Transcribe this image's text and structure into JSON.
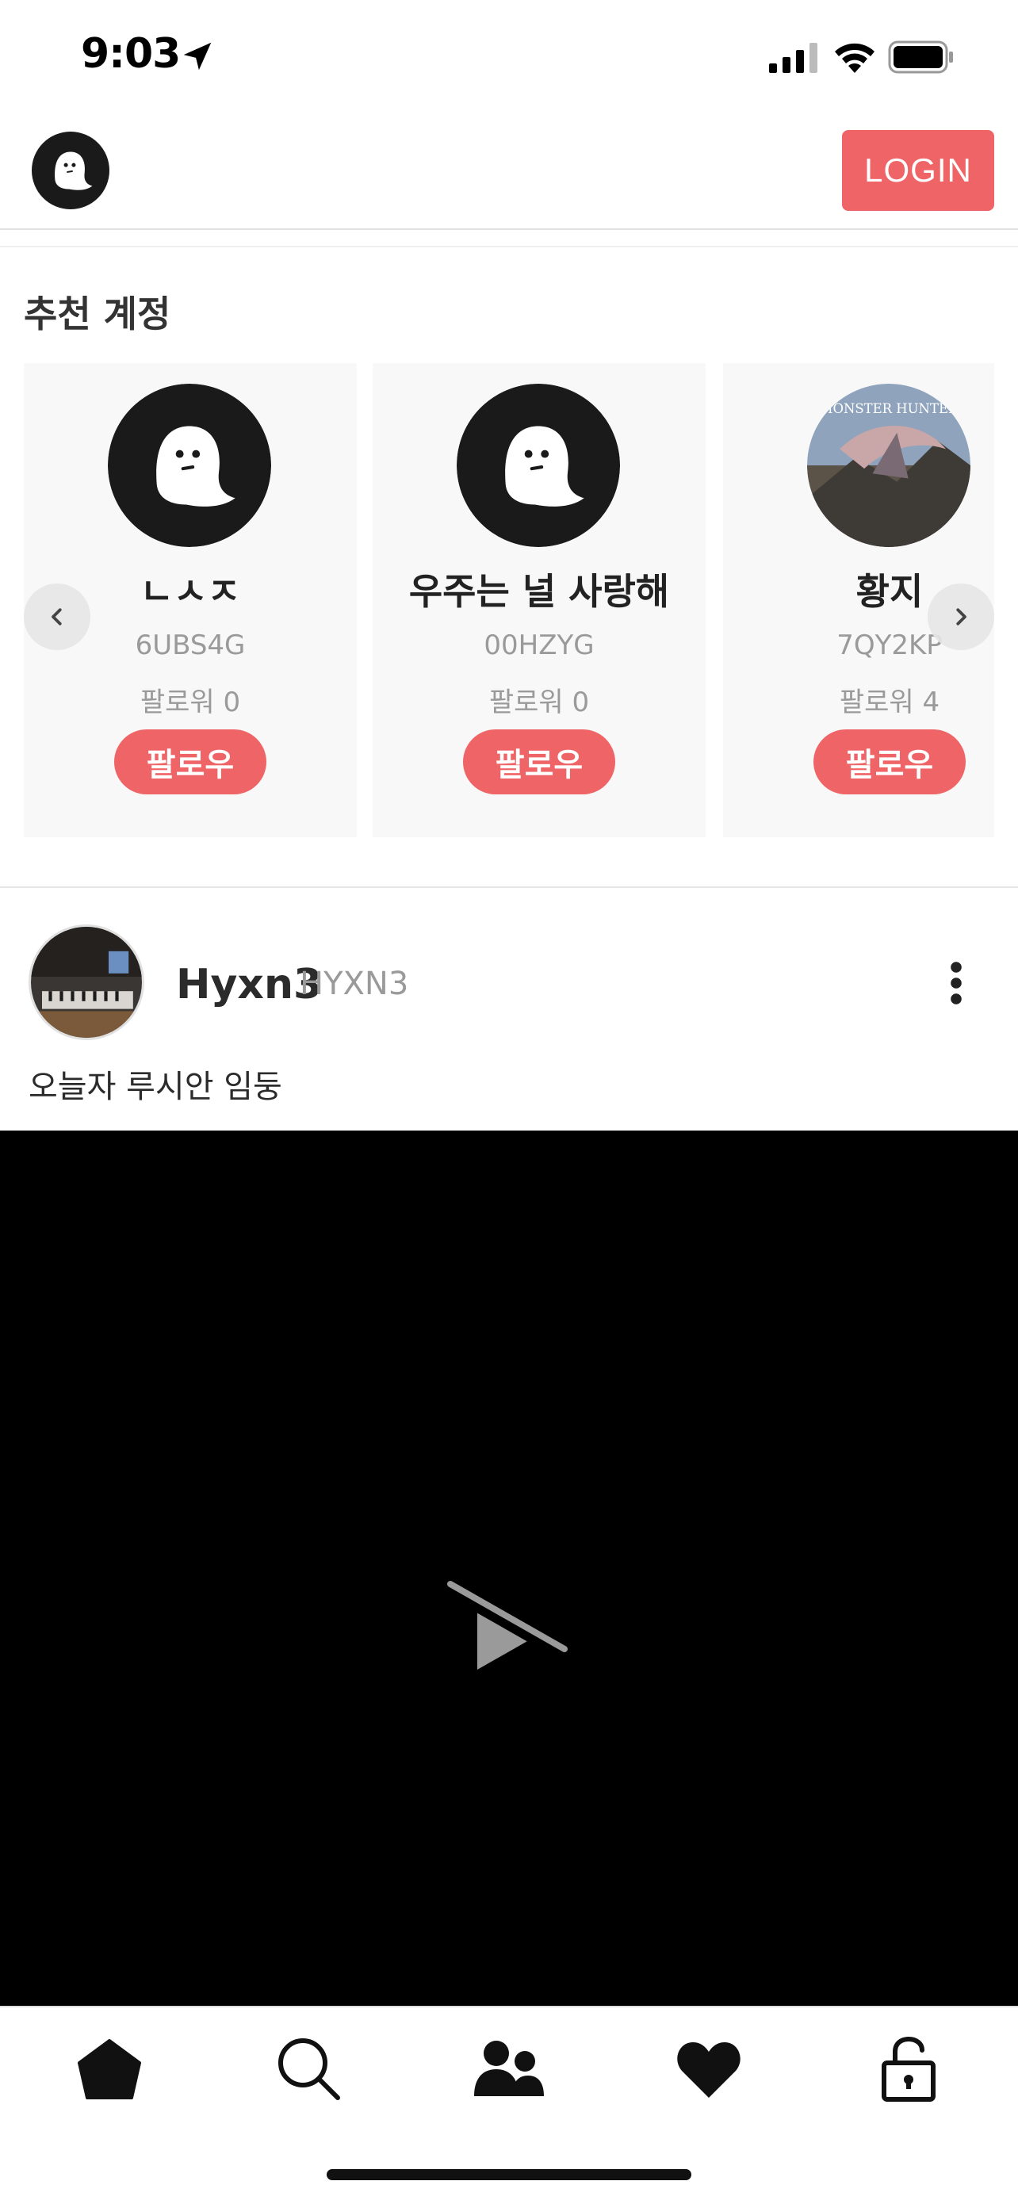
{
  "status_bar": {
    "time": "9:03"
  },
  "header": {
    "login_label": "LOGIN"
  },
  "recommended": {
    "title": "추천 계정",
    "follow_label": "팔로우",
    "accounts": [
      {
        "name": "ㄴㅅㅈ",
        "handle": "6UBS4G",
        "followers": "팔로워 0",
        "avatar": "ghost-avatar"
      },
      {
        "name": "우주는 널 사랑해",
        "handle": "00HZYG",
        "followers": "팔로워 0",
        "avatar": "ghost-avatar"
      },
      {
        "name": "황지",
        "handle": "7QY2KP",
        "followers": "팔로워 4",
        "avatar": "monster-hunter-avatar"
      }
    ]
  },
  "post": {
    "author": "Hyxn3",
    "handle": "HYXN3",
    "caption": "오늘자 루시안 임둥",
    "video_icon": "video-unavailable-icon"
  },
  "tabs": [
    "home-icon",
    "search-icon",
    "friends-icon",
    "heart-icon",
    "lock-icon"
  ],
  "colors": {
    "accent": "#ef6466",
    "video_bg": "#000000"
  }
}
